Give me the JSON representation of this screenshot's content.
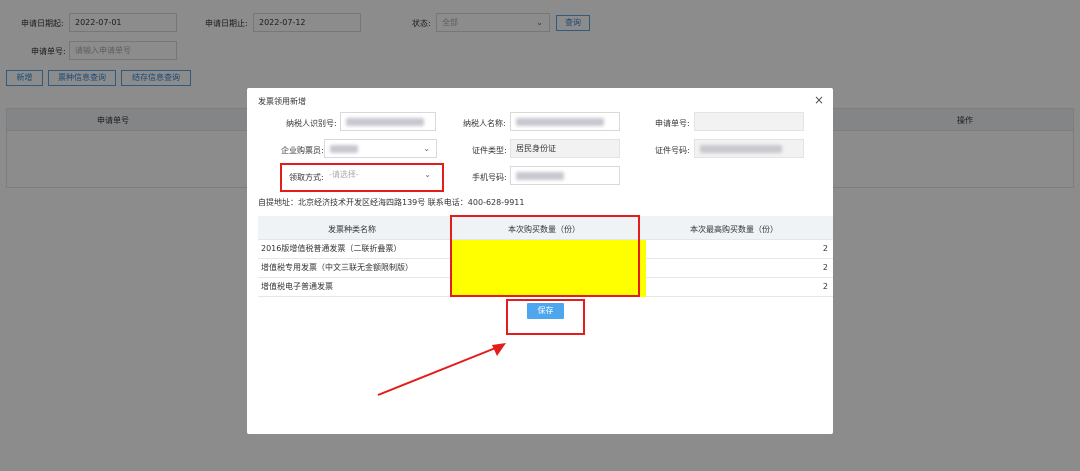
{
  "filters": {
    "start_label": "申请日期起:",
    "start_value": "2022-07-01",
    "end_label": "申请日期止:",
    "end_value": "2022-07-12",
    "status_label": "状态:",
    "status_value": "全部",
    "query_button": "查询",
    "appno_label": "申请单号:",
    "appno_placeholder": "请输入申请单号"
  },
  "toolbar": {
    "add": "新增",
    "ticket_query": "票种信息查询",
    "stock_query": "结存信息查询"
  },
  "bg_table": {
    "col_appno": "申请单号",
    "col_ops": "操作"
  },
  "modal": {
    "title": "发票领用新增",
    "close": "×",
    "taxpayer_id_label": "纳税人识别号:",
    "taxpayer_name_label": "纳税人名称:",
    "app_no_label": "申请单号:",
    "buyer_label": "企业购票员:",
    "cert_type_label": "证件类型:",
    "cert_type_value": "居民身份证",
    "cert_no_label": "证件号码:",
    "method_label": "领取方式:",
    "method_placeholder": "-请选择-",
    "phone_label": "手机号码:",
    "address": "自提地址：北京经济技术开发区经海四路139号 联系电话：400-628-9911",
    "table": {
      "headers": [
        "发票种类名称",
        "本次购买数量（份）",
        "本次最高购买数量（份）"
      ],
      "rows": [
        {
          "name": "2016版增值税普通发票（二联折叠票）",
          "qty": "",
          "max": "2"
        },
        {
          "name": "增值税专用发票（中文三联无金额限制版）",
          "qty": "",
          "max": "2"
        },
        {
          "name": "增值税电子普通发票",
          "qty": "",
          "max": "2"
        }
      ]
    },
    "save": "保存"
  },
  "colors": {
    "highlight_yellow": "#ffff00",
    "annotation_red": "#e51c1c",
    "primary_blue": "#4ea7ee"
  }
}
